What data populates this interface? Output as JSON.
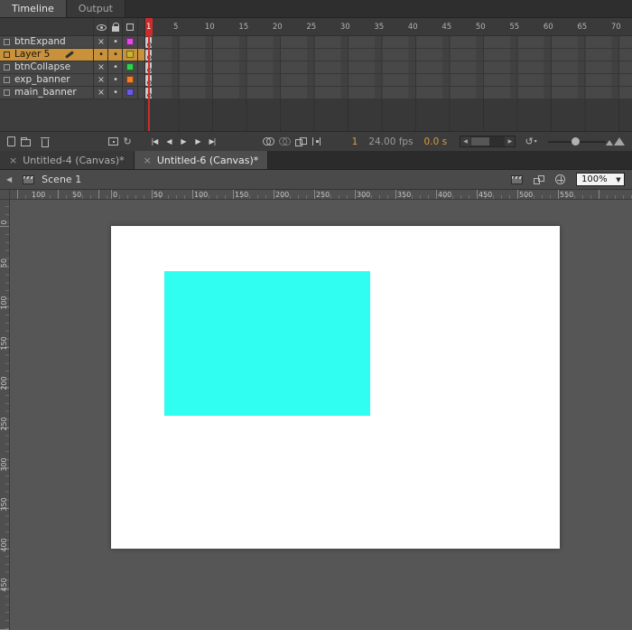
{
  "panel_tabs": [
    {
      "label": "Timeline",
      "active": true
    },
    {
      "label": "Output",
      "active": false
    }
  ],
  "timeline": {
    "frame_numbers": [
      1,
      5,
      10,
      15,
      20,
      25,
      30,
      35,
      40,
      45,
      50,
      55,
      60,
      65,
      70
    ],
    "glyphs": {
      "hidden": "×",
      "dot": "•"
    },
    "layers": [
      {
        "name": "btnExpand",
        "visible": false,
        "locked": false,
        "outline_color": "#e14ae1",
        "selected": false
      },
      {
        "name": "Layer 5",
        "visible": true,
        "locked": false,
        "outline_color": "#c7b52f",
        "selected": true
      },
      {
        "name": "btnCollapse",
        "visible": false,
        "locked": false,
        "outline_color": "#2fd14f",
        "selected": false
      },
      {
        "name": "exp_banner",
        "visible": false,
        "locked": false,
        "outline_color": "#f07f2a",
        "selected": false
      },
      {
        "name": "main_banner",
        "visible": false,
        "locked": false,
        "outline_color": "#6a5ae0",
        "selected": false
      }
    ],
    "toolbar": {
      "playback": [
        "|◀",
        "◀",
        "▶",
        "▶",
        "▶|"
      ],
      "current_frame": "1",
      "frame_rate": "24.00 fps",
      "elapsed_time": "0.0 s",
      "loop_glyph": "↻",
      "reset_glyph": "↺"
    }
  },
  "document_tabs": [
    {
      "label": "Untitled-4 (Canvas)*",
      "close": "×",
      "active": false
    },
    {
      "label": "Untitled-6 (Canvas)*",
      "close": "×",
      "active": true
    }
  ],
  "edit_bar": {
    "scene_label": "Scene 1",
    "zoom_value": "100%"
  },
  "rulers": {
    "horizontal_labels": [
      "100",
      "50",
      "0",
      "50",
      "100",
      "150",
      "200",
      "250",
      "300",
      "350",
      "400",
      "450",
      "500",
      "550"
    ],
    "vertical_labels": [
      "0",
      "50",
      "100",
      "150",
      "200",
      "250",
      "300",
      "350",
      "400",
      "450"
    ]
  },
  "canvas": {
    "stage_color": "#ffffff",
    "shape_color": "#30fef0"
  },
  "colors": {
    "playhead": "#cf2b2b",
    "selected_layer": "#c8913a",
    "counter_orange": "#d89b3a"
  }
}
